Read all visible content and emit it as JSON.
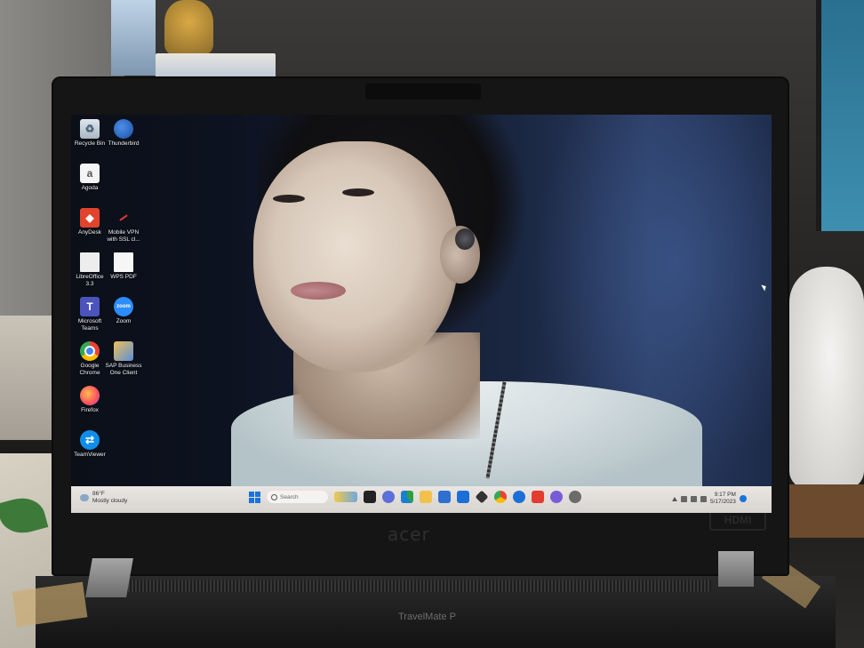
{
  "desktop": {
    "icons": [
      {
        "label": "Recycle Bin",
        "glyph": "♻"
      },
      {
        "label": "Thunderbird",
        "glyph": ""
      },
      {
        "label": "Agoda",
        "glyph": "a"
      },
      {
        "label": "AnyDesk",
        "glyph": "◆"
      },
      {
        "label": "Mobile VPN with SSL cl...",
        "glyph": ""
      },
      {
        "label": "LibreOffice 3.3",
        "glyph": ""
      },
      {
        "label": "WPS PDF",
        "glyph": ""
      },
      {
        "label": "Microsoft Teams",
        "glyph": "T"
      },
      {
        "label": "Zoom",
        "glyph": "zoom"
      },
      {
        "label": "Google Chrome",
        "glyph": ""
      },
      {
        "label": "SAP Business One Client",
        "glyph": ""
      },
      {
        "label": "Firefox",
        "glyph": ""
      },
      {
        "label": "TeamViewer",
        "glyph": "⇄"
      }
    ]
  },
  "taskbar": {
    "weather_temp": "86°F",
    "weather_desc": "Mostly cloudy",
    "search_placeholder": "Search",
    "clock_time": "9:17 PM",
    "clock_date": "5/17/2023"
  },
  "hardware": {
    "brand": "acer",
    "model": "TravelMate P",
    "port_logo": "HDMI"
  },
  "colors": {
    "taskbar_bg": "#e4e0dc",
    "accent": "#1a73d9"
  }
}
